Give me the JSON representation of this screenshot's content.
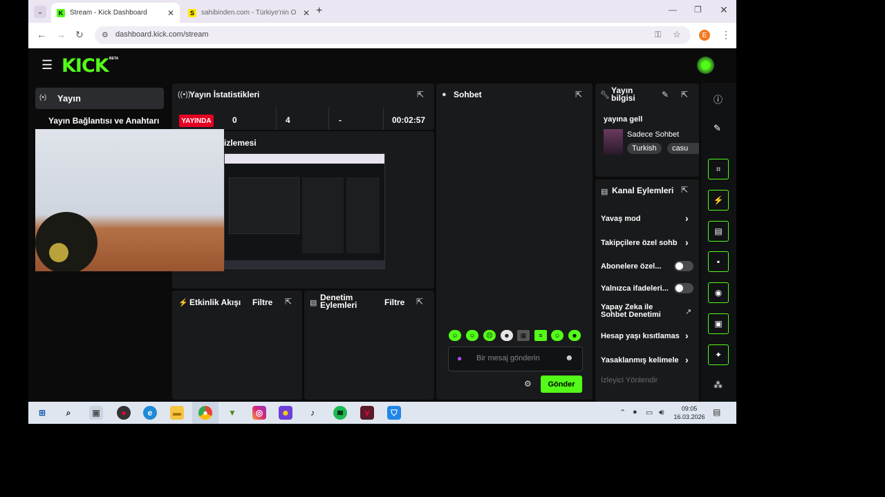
{
  "browser": {
    "tabs": [
      {
        "title": "Stream - Kick Dashboard",
        "favicon": "K",
        "color": "#53fc18"
      },
      {
        "title": "sahibinden.com - Türkiye'nin O",
        "favicon": "S",
        "color": "#ffe800"
      }
    ],
    "url": "dashboard.kick.com/stream",
    "profile_initial": "E"
  },
  "kick": {
    "logo": "KICK",
    "logo_badge": "BETA"
  },
  "sidebar": {
    "items": [
      {
        "label": "Yayın",
        "icon": "broadcast-icon"
      },
      {
        "label": "Yayın Bağlantısı ve Anahtarı"
      }
    ]
  },
  "stats": {
    "title": "Yayın İstatistikleri",
    "live_badge": "YAYINDA",
    "values": [
      "0",
      "4",
      "-",
      "00:02:57"
    ]
  },
  "preview": {
    "title": "izlemesi"
  },
  "chat": {
    "title": "Sohbet",
    "placeholder": "Bir mesaj gönderin",
    "send_label": "Gönder"
  },
  "stream_info": {
    "title_line1": "Yayın",
    "title_line2": "bilgisi",
    "stream_title": "yayına gell",
    "category": "Sadece Sohbet",
    "tags": [
      "Turkish",
      "casu"
    ]
  },
  "channel_actions": {
    "title": "Kanal Eylemleri",
    "rows": [
      {
        "label": "Yavaş mod",
        "kind": "chevron"
      },
      {
        "label": "Takipçilere özel sohb",
        "kind": "chevron"
      },
      {
        "label": "Abonelere özel...",
        "kind": "toggle"
      },
      {
        "label": "Yalnızca ifadeleri...",
        "kind": "toggle"
      },
      {
        "label": "Yapay Zeka ile Sohbet Denetimi",
        "kind": "external"
      },
      {
        "label": "Hesap yaşı kısıtlamas",
        "kind": "chevron"
      },
      {
        "label": "Yasaklanmış kelimele",
        "kind": "chevron"
      },
      {
        "label": "İzleyici Yönlendir",
        "kind": "disabled"
      }
    ]
  },
  "activity": {
    "title": "Etkinlik Akışı",
    "filter": "Filtre"
  },
  "moderation": {
    "title_line1": "Denetim",
    "title_line2": "Eylemleri",
    "filter": "Filtre"
  },
  "taskbar": {
    "time": "09:05",
    "date": "16.03.2026"
  },
  "colors": {
    "kick_green": "#53fc18",
    "live_red": "#e60023",
    "panel": "#191a1c"
  }
}
